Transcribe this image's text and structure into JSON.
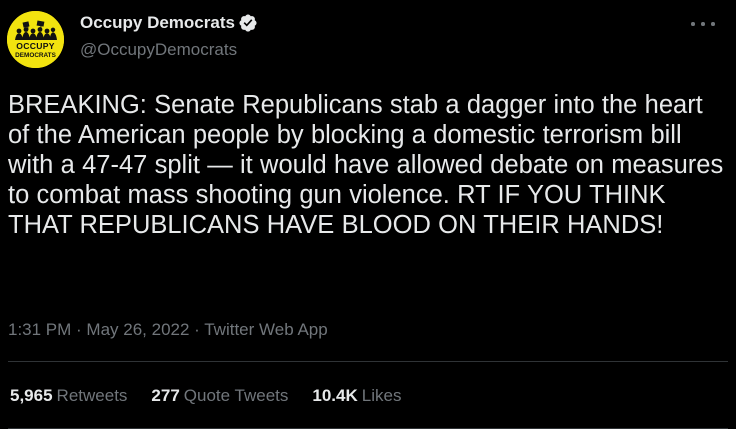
{
  "author": {
    "name": "Occupy Democrats",
    "handle": "@OccupyDemocrats",
    "avatar_text_line1": "OCCUPY",
    "avatar_text_line2": "DEMOCRATS",
    "verified": true
  },
  "tweet": {
    "text": "BREAKING: Senate Republicans stab a dagger into the heart of the American people by blocking a domestic terrorism bill with a 47-47 split — it would have allowed debate on measures to combat mass shooting gun violence. RT IF YOU THINK THAT REPUBLICANS HAVE BLOOD ON THEIR HANDS!",
    "meta": "1:31 PM · May 26, 2022 · Twitter Web App"
  },
  "stats": [
    {
      "count": "5,965",
      "label": "Retweets"
    },
    {
      "count": "277",
      "label": "Quote Tweets"
    },
    {
      "count": "10.4K",
      "label": "Likes"
    }
  ],
  "icons": {
    "more": "more-options-icon",
    "verified": "verified-badge-icon"
  },
  "colors": {
    "background": "#000000",
    "text": "#e7e9ea",
    "secondary": "#71767b",
    "avatar_bg": "#f2e30f",
    "divider": "#2f3336"
  }
}
